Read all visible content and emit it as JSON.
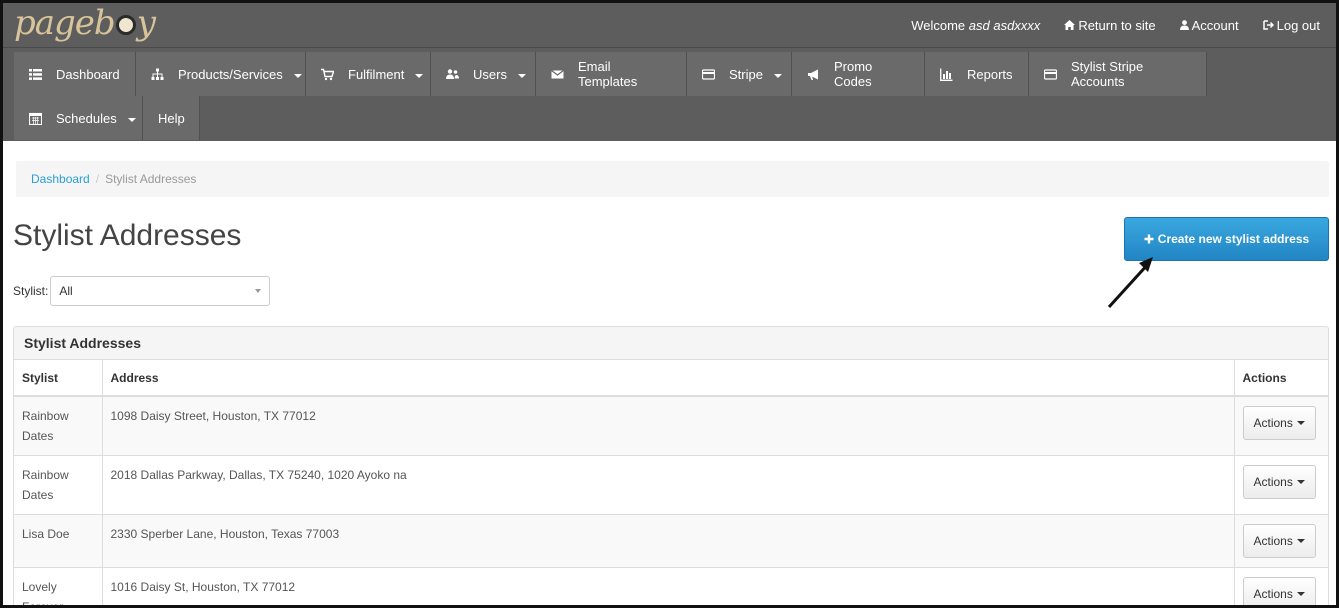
{
  "brand": {
    "logo_text_1": "page",
    "logo_text_2": "b",
    "logo_text_3": "y"
  },
  "topbar": {
    "welcome_prefix": "Welcome",
    "user_name": "asd asdxxxx",
    "return_label": "Return to site",
    "account_label": "Account",
    "logout_label": "Log out"
  },
  "nav": {
    "row1": [
      {
        "label": "Dashboard",
        "icon": "list-icon",
        "dropdown": false
      },
      {
        "label": "Products/Services",
        "icon": "sitemap-icon",
        "dropdown": true
      },
      {
        "label": "Fulfilment",
        "icon": "cart-icon",
        "dropdown": true
      },
      {
        "label": "Users",
        "icon": "users-icon",
        "dropdown": true
      },
      {
        "label": "Email Templates",
        "icon": "envelope-icon",
        "dropdown": false
      },
      {
        "label": "Stripe",
        "icon": "credit-card-icon",
        "dropdown": true
      },
      {
        "label": "Promo Codes",
        "icon": "bullhorn-icon",
        "dropdown": false
      },
      {
        "label": "Reports",
        "icon": "bar-chart-icon",
        "dropdown": false
      },
      {
        "label": "Stylist Stripe Accounts",
        "icon": "credit-card-icon",
        "dropdown": false
      }
    ],
    "row2": [
      {
        "label": "Schedules",
        "icon": "calendar-icon",
        "dropdown": true
      },
      {
        "label": "Help",
        "icon": "",
        "dropdown": false
      }
    ]
  },
  "breadcrumb": {
    "root": "Dashboard",
    "current": "Stylist Addresses"
  },
  "page": {
    "title": "Stylist Addresses",
    "create_button": "Create new stylist address",
    "filter_label": "Stylist:",
    "filter_value": "All"
  },
  "panel": {
    "heading": "Stylist Addresses",
    "columns": [
      "Stylist",
      "Address",
      "Actions"
    ],
    "rows": [
      {
        "stylist": "Rainbow Dates",
        "address": "1098 Daisy Street, Houston, TX 77012",
        "action": "Actions"
      },
      {
        "stylist": "Rainbow Dates",
        "address": "2018 Dallas Parkway, Dallas, TX 75240, 1020 Ayoko na",
        "action": "Actions"
      },
      {
        "stylist": "Lisa Doe",
        "address": "2330 Sperber Lane, Houston, Texas 77003",
        "action": "Actions"
      },
      {
        "stylist": "Lovely Forever",
        "address": "1016 Daisy St, Houston, TX 77012",
        "action": "Actions"
      }
    ]
  },
  "colors": {
    "nav_bg": "#5d5d5d",
    "nav_item_bg": "#6a6a6a",
    "primary": "#2a9fd6",
    "logo": "#d8c49a"
  }
}
